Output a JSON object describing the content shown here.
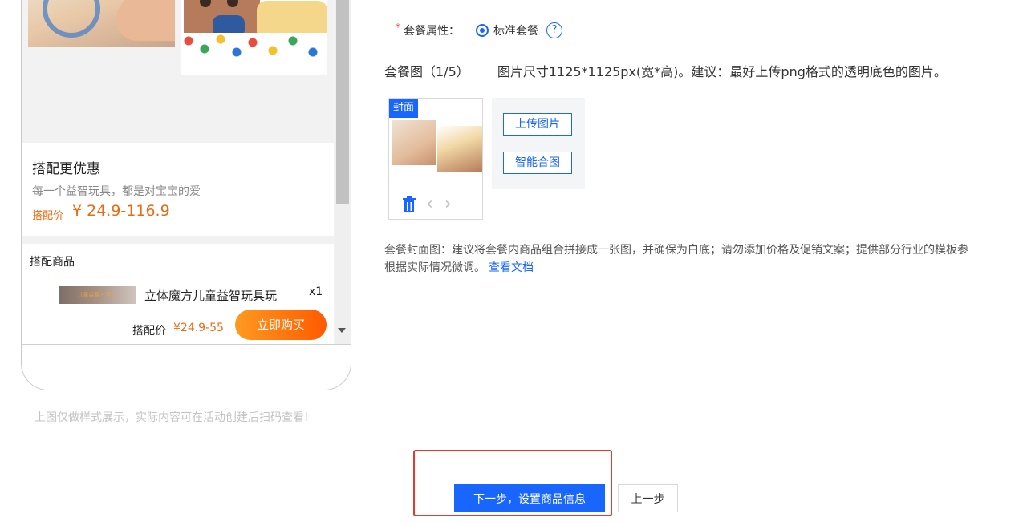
{
  "preview": {
    "promo": {
      "title": "搭配更优惠",
      "subtitle": "每一个益智玩具，都是对宝宝的爱",
      "price_label": "搭配价",
      "price": "¥ 24.9-116.9"
    },
    "items": {
      "title": "搭配商品",
      "thumb_text": "儿童益智三合一",
      "item_name": "立体魔方儿童益智玩具玩",
      "item_qty": "x1",
      "price_label": "搭配价",
      "price": "¥24.9-55",
      "buy_label": "立即购买"
    },
    "note": "上图仅做样式展示，实际内容可在活动创建后扫码查看!"
  },
  "form": {
    "attr_label": "套餐属性：",
    "attr_option": "标准套餐",
    "help_icon": "?",
    "pkg_img_title": "套餐图（1/5）",
    "pkg_img_hint": "图片尺寸1125*1125px(宽*高)。建议：最好上传png格式的透明底色的图片。",
    "cover_badge": "封面",
    "upload_btn": "上传图片",
    "smart_btn": "智能合图",
    "cover_tip_line1": "套餐封面图：建议将套餐内商品组合拼接成一张图，并确保为白底；请勿添加价格及促销文案；提供部分行业的模板参",
    "cover_tip_line2": "根据实际情况微调。",
    "doc_link": "查看文档"
  },
  "actions": {
    "next_label": "下一步，设置商品信息",
    "prev_label": "上一步"
  },
  "colors": {
    "primary": "#1966ff",
    "orange": "#e86b13",
    "highlight": "#e23a2f"
  },
  "icons": {
    "trash": "trash-icon",
    "prev": "chevron-left-icon",
    "next": "chevron-right-icon",
    "help": "help-circle-icon"
  }
}
